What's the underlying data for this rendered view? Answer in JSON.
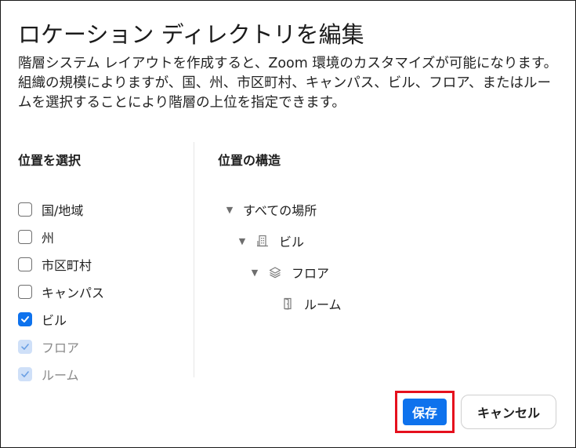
{
  "dialog": {
    "title": "ロケーション ディレクトリを編集",
    "description": "階層システム レイアウトを作成すると、Zoom 環境のカスタマイズが可能になります。組織の規模によりますが、国、州、市区町村、キャンパス、ビル、フロア、またはルームを選択することにより階層の上位を指定できます。"
  },
  "select_section": {
    "heading": "位置を選択",
    "items": [
      {
        "label": "国/地域",
        "state": "unchecked"
      },
      {
        "label": "州",
        "state": "unchecked"
      },
      {
        "label": "市区町村",
        "state": "unchecked"
      },
      {
        "label": "キャンパス",
        "state": "unchecked"
      },
      {
        "label": "ビル",
        "state": "checked"
      },
      {
        "label": "フロア",
        "state": "implied"
      },
      {
        "label": "ルーム",
        "state": "implied"
      }
    ]
  },
  "structure_section": {
    "heading": "位置の構造",
    "nodes": [
      {
        "label": "すべての場所",
        "icon": "none",
        "expanded": true
      },
      {
        "label": "ビル",
        "icon": "building-icon",
        "expanded": true
      },
      {
        "label": "フロア",
        "icon": "layers-icon",
        "expanded": true
      },
      {
        "label": "ルーム",
        "icon": "door-icon",
        "expanded": false
      }
    ]
  },
  "buttons": {
    "save": "保存",
    "cancel": "キャンセル"
  },
  "colors": {
    "primary": "#0e72ed",
    "highlight_frame": "#e5101d",
    "implied_check_bg": "#cfe0f8"
  }
}
